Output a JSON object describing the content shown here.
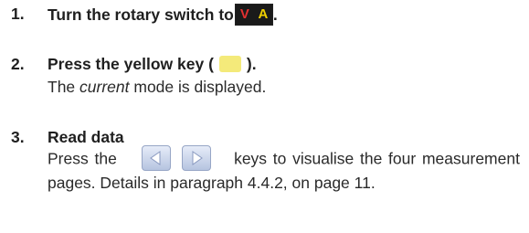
{
  "steps": [
    {
      "number": "1.",
      "heading_before": "Turn the rotary switch to",
      "switch_v": "V",
      "switch_a": "A",
      "heading_after": "."
    },
    {
      "number": "2.",
      "heading_before": "Press the yellow key (",
      "heading_after": ").",
      "text_before": "The ",
      "text_em": "current",
      "text_after": " mode is displayed."
    },
    {
      "number": "3.",
      "heading": "Read data",
      "text_before": "Press the",
      "text_after": "keys to visualise the four measurement pages. Details in paragraph 4.4.2, on page 11."
    }
  ],
  "colors": {
    "yellow_key": "#f4ea7a",
    "switch_v": "#e23030",
    "switch_a": "#f0d000",
    "arrow_key": "#b6c4e0"
  },
  "icons": [
    "rotary-switch-va-icon",
    "yellow-key-icon",
    "left-arrow-key-icon",
    "right-arrow-key-icon"
  ]
}
